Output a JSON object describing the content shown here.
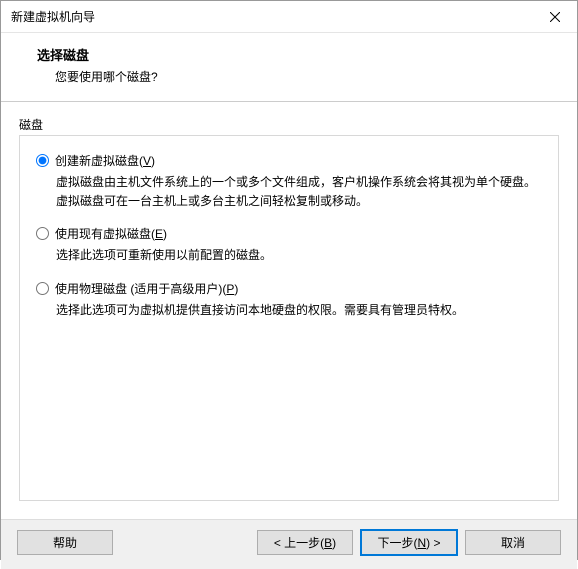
{
  "window": {
    "title": "新建虚拟机向导"
  },
  "header": {
    "title": "选择磁盘",
    "subtitle": "您要使用哪个磁盘?"
  },
  "group": {
    "label": "磁盘"
  },
  "options": {
    "create": {
      "label_pre": "创建新虚拟磁盘(",
      "label_key": "V",
      "label_post": ")",
      "description": "虚拟磁盘由主机文件系统上的一个或多个文件组成，客户机操作系统会将其视为单个硬盘。虚拟磁盘可在一台主机上或多台主机之间轻松复制或移动。"
    },
    "existing": {
      "label_pre": "使用现有虚拟磁盘(",
      "label_key": "E",
      "label_post": ")",
      "description": "选择此选项可重新使用以前配置的磁盘。"
    },
    "physical": {
      "label_pre": "使用物理磁盘 (适用于高级用户)(",
      "label_key": "P",
      "label_post": ")",
      "description": "选择此选项可为虚拟机提供直接访问本地硬盘的权限。需要具有管理员特权。"
    }
  },
  "buttons": {
    "help": "帮助",
    "back_pre": "< 上一步(",
    "back_key": "B",
    "back_post": ")",
    "next_pre": "下一步(",
    "next_key": "N",
    "next_post": ") >",
    "cancel": "取消"
  }
}
